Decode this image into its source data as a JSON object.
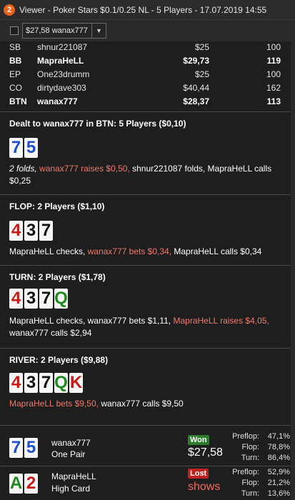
{
  "window": {
    "icon_text": "2",
    "title": "Viewer - Poker Stars $0.1/0.25 NL - 5 Players - 17.07.2019 14:55"
  },
  "toolbar": {
    "combo_value": "$27,58 wanax777"
  },
  "players": [
    {
      "pos": "SB",
      "name": "shnur221087",
      "stack": "$25",
      "bb": "100",
      "bold": false
    },
    {
      "pos": "BB",
      "name": "MapraHeLL",
      "stack": "$29,73",
      "bb": "119",
      "bold": true
    },
    {
      "pos": "EP",
      "name": "One23drumm",
      "stack": "$25",
      "bb": "100",
      "bold": false
    },
    {
      "pos": "CO",
      "name": "dirtydave303",
      "stack": "$40,44",
      "bb": "162",
      "bold": false
    },
    {
      "pos": "BTN",
      "name": "wanax777",
      "stack": "$28,37",
      "bb": "113",
      "bold": true
    }
  ],
  "preflop": {
    "header": "Dealt to wanax777 in BTN: 5 Players ($0,10)",
    "cards": [
      {
        "rank": "7",
        "color": "blue"
      },
      {
        "rank": "5",
        "color": "blue"
      }
    ],
    "action_1": "2 folds, ",
    "action_2": "wanax777 raises $0,50, ",
    "action_3": "shnur221087 folds, MapraHeLL calls",
    "action_4": "$0,25"
  },
  "flop": {
    "header": "FLOP: 2 Players ($1,10)",
    "cards": [
      {
        "rank": "4",
        "color": "red"
      },
      {
        "rank": "3",
        "color": "black"
      },
      {
        "rank": "7",
        "color": "black"
      }
    ],
    "action_1": "MapraHeLL checks, ",
    "action_2": "wanax777 bets $0,34, ",
    "action_3": "MapraHeLL calls $0,34"
  },
  "turn": {
    "header": "TURN: 2 Players ($1,78)",
    "cards": [
      {
        "rank": "4",
        "color": "red"
      },
      {
        "rank": "3",
        "color": "black"
      },
      {
        "rank": "7",
        "color": "black"
      },
      {
        "rank": "Q",
        "color": "green"
      }
    ],
    "action_1": "MapraHeLL checks, wanax777 bets $1,11, ",
    "action_2": "MapraHeLL raises $4,05,",
    "action_3": "wanax777 calls $2,94"
  },
  "river": {
    "header": "RIVER: 2 Players ($9,88)",
    "cards": [
      {
        "rank": "4",
        "color": "red"
      },
      {
        "rank": "3",
        "color": "black"
      },
      {
        "rank": "7",
        "color": "black"
      },
      {
        "rank": "Q",
        "color": "green"
      },
      {
        "rank": "K",
        "color": "red"
      }
    ],
    "action_1": "MapraHeLL bets $9,50, ",
    "action_2": "wanax777 calls $9,50"
  },
  "summary": [
    {
      "cards": [
        {
          "rank": "7",
          "color": "blue"
        },
        {
          "rank": "5",
          "color": "blue"
        }
      ],
      "name": "wanax777",
      "hand": "One Pair",
      "badge": "Won",
      "result": "$27,58",
      "stats": [
        {
          "label": "Preflop:",
          "value": "47,1%"
        },
        {
          "label": "Flop:",
          "value": "78,8%"
        },
        {
          "label": "Turn:",
          "value": "86,4%"
        }
      ]
    },
    {
      "cards": [
        {
          "rank": "A",
          "color": "green"
        },
        {
          "rank": "2",
          "color": "red"
        }
      ],
      "name": "MapraHeLL",
      "hand": "High Card",
      "badge": "Lost",
      "result": "shows",
      "stats": [
        {
          "label": "Preflop:",
          "value": "52,9%"
        },
        {
          "label": "Flop:",
          "value": "21,2%"
        },
        {
          "label": "Turn:",
          "value": "13,6%"
        }
      ]
    }
  ],
  "colors": {
    "highlight": "#ee7a6f",
    "won": "#2e7d2e",
    "lost": "#c02020"
  }
}
